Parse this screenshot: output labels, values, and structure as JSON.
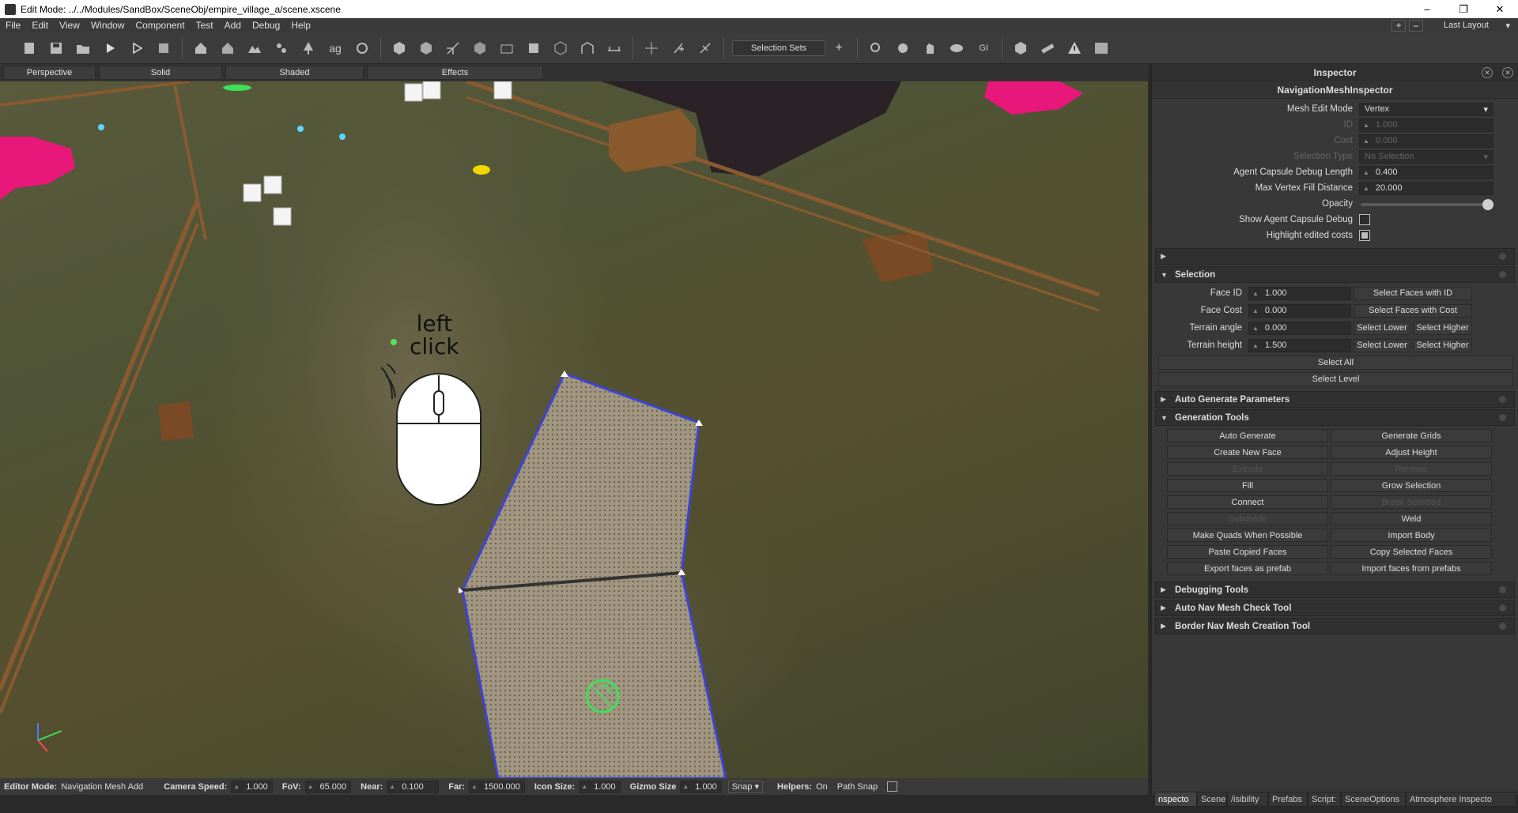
{
  "window": {
    "title": "Edit Mode: ../../Modules/SandBox/SceneObj/empire_village_a/scene.xscene",
    "controls": [
      "–",
      "❐",
      "✕"
    ]
  },
  "menu": {
    "items": [
      "File",
      "Edit",
      "View",
      "Window",
      "Component",
      "Test",
      "Add",
      "Debug",
      "Help"
    ],
    "add_label": "+",
    "remove_label": "–",
    "layout_label": "Last Layout"
  },
  "toolbar": {
    "selection_sets_label": "Selection Sets",
    "add_label": "+"
  },
  "viewtabs": [
    "Perspective",
    "Solid",
    "Shaded",
    "Effects"
  ],
  "viewport": {
    "overlay_line1": "left",
    "overlay_line2": "click"
  },
  "inspector": {
    "title": "Inspector",
    "component_title": "NavigationMeshInspector",
    "mesh_edit_mode": {
      "label": "Mesh Edit Mode",
      "value": "Vertex"
    },
    "disabled_fields": [
      {
        "label": "ID",
        "value": "1.000"
      },
      {
        "label": "Cost",
        "value": "0.000"
      }
    ],
    "selection_type": {
      "label": "Selection Type",
      "value": "No Selection"
    },
    "agent_capsule_length": {
      "label": "Agent Capsule Debug Length",
      "value": "0.400"
    },
    "max_vertex_fill": {
      "label": "Max Vertex Fill Distance",
      "value": "20.000"
    },
    "opacity": {
      "label": "Opacity",
      "level": 1.0
    },
    "show_agent_capsule": {
      "label": "Show Agent Capsule Debug",
      "checked": false
    },
    "highlight_edited": {
      "label": "Highlight edited costs",
      "checked": true
    },
    "selection": {
      "title": "Selection",
      "face_id": {
        "label": "Face ID",
        "value": "1.000",
        "button": "Select Faces with ID"
      },
      "face_cost": {
        "label": "Face Cost",
        "value": "0.000",
        "button": "Select Faces with Cost"
      },
      "terrain_angle": {
        "label": "Terrain angle",
        "value": "0.000",
        "lower": "Select Lower",
        "higher": "Select Higher"
      },
      "terrain_height": {
        "label": "Terrain height",
        "value": "1.500",
        "lower": "Select Lower",
        "higher": "Select Higher"
      },
      "select_all": "Select All",
      "select_level": "Select Level"
    },
    "auto_generate_params": "Auto Generate Parameters",
    "generation_tools": {
      "title": "Generation Tools",
      "buttons": [
        {
          "label": "Auto Generate",
          "enabled": true
        },
        {
          "label": "Generate Grids",
          "enabled": true
        },
        {
          "label": "Create New Face",
          "enabled": true
        },
        {
          "label": "Adjust Height",
          "enabled": true
        },
        {
          "label": "Extrude",
          "enabled": false
        },
        {
          "label": "Remove",
          "enabled": false
        },
        {
          "label": "Fill",
          "enabled": true
        },
        {
          "label": "Grow Selection",
          "enabled": true
        },
        {
          "label": "Connect",
          "enabled": true
        },
        {
          "label": "Break Selected",
          "enabled": false
        },
        {
          "label": "Subdivide",
          "enabled": false
        },
        {
          "label": "Weld",
          "enabled": true
        },
        {
          "label": "Make Quads When Possible",
          "enabled": true
        },
        {
          "label": "Import Body",
          "enabled": true
        },
        {
          "label": "Paste Copied Faces",
          "enabled": true
        },
        {
          "label": "Copy Selected Faces",
          "enabled": true
        },
        {
          "label": "Export faces as prefab",
          "enabled": true
        },
        {
          "label": "Import faces from prefabs",
          "enabled": true
        }
      ]
    },
    "debugging_tools": "Debugging Tools",
    "auto_nav_mesh_check": "Auto Nav Mesh Check Tool",
    "border_nav_mesh": "Border Nav Mesh Creation Tool"
  },
  "statusbar": {
    "editor_mode_label": "Editor Mode:",
    "editor_mode_value": "Navigation Mesh Add",
    "camera_speed_label": "Camera Speed:",
    "camera_speed": "1.000",
    "fov_label": "FoV:",
    "fov": "65.000",
    "near_label": "Near:",
    "near": "0.100",
    "far_label": "Far:",
    "far": "1500.000",
    "icon_size_label": "Icon Size:",
    "icon_size": "1.000",
    "gizmo_size_label": "Gizmo Size",
    "gizmo_size": "1.000",
    "snap_label": "Snap",
    "helpers_label": "Helpers:",
    "helpers_value": "On",
    "path_snap_label": "Path Snap"
  },
  "dock_tabs": [
    "nspecto",
    "Scene",
    "/isibility",
    "Prefabs",
    "Script:",
    "SceneOptions",
    "Atmosphere Inspecto"
  ]
}
